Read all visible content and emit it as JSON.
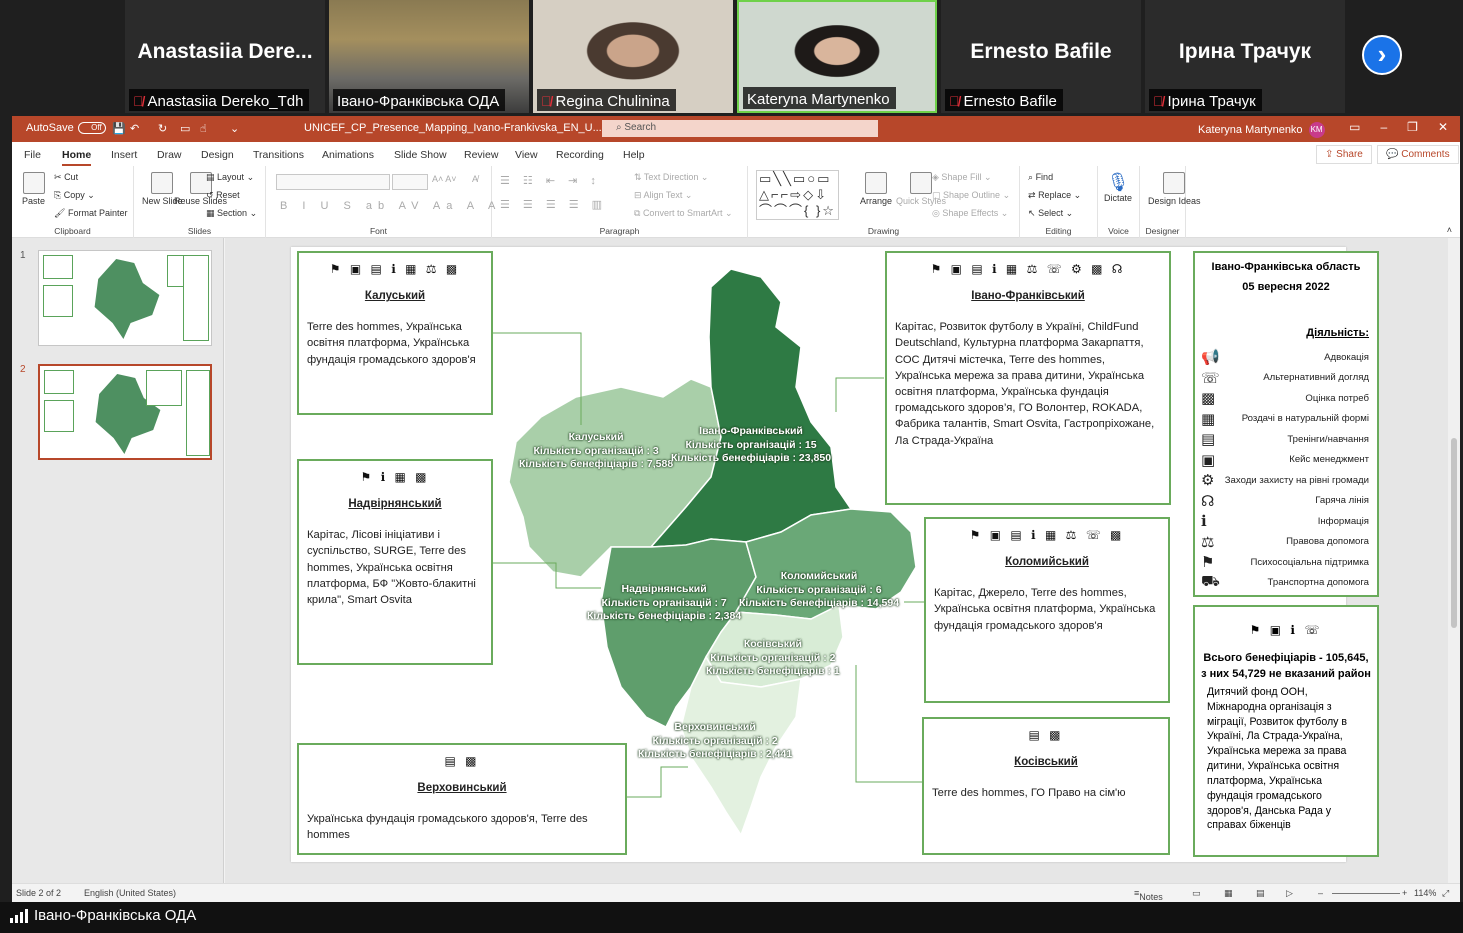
{
  "video": {
    "tiles": [
      {
        "big_name": "Anastasiia  Dere...",
        "caption": "Anastasiia Dereko_Tdh",
        "muted": true
      },
      {
        "caption": "Івано-Франківська ОДА",
        "muted": false
      },
      {
        "caption": "Regina Chulinina",
        "muted": true
      },
      {
        "caption": "Kateryna Martynenko",
        "muted": false
      },
      {
        "big_name": "Ernesto Bafile",
        "caption": "Ernesto Bafile",
        "muted": true
      },
      {
        "big_name": "Ірина Трачук",
        "caption": "Ірина Трачук",
        "muted": true
      }
    ],
    "next_icon": "chevron-right-icon",
    "bottom_caption": "Івано-Франківська ОДА"
  },
  "ppt": {
    "autosave_label": "AutoSave",
    "autosave_state": "Off",
    "file_name": "UNICEF_CP_Presence_Mapping_Ivano-Frankivska_EN_U...",
    "search_placeholder": "Search",
    "user_name": "Kateryna Martynenko",
    "user_initials": "KM",
    "menu": [
      "File",
      "Home",
      "Insert",
      "Draw",
      "Design",
      "Transitions",
      "Animations",
      "Slide Show",
      "Review",
      "View",
      "Recording",
      "Help"
    ],
    "active_menu": "Home",
    "share_label": "Share",
    "comments_label": "Comments",
    "ribbon": {
      "clipboard": {
        "label": "Clipboard",
        "paste": "Paste",
        "cut": "Cut",
        "copy": "Copy",
        "format_painter": "Format Painter"
      },
      "slides": {
        "label": "Slides",
        "new_slide": "New Slide",
        "reuse": "Reuse Slides",
        "layout": "Layout",
        "reset": "Reset",
        "section": "Section"
      },
      "font": {
        "label": "Font"
      },
      "paragraph": {
        "label": "Paragraph",
        "text_direction": "Text Direction",
        "align_text": "Align Text",
        "convert": "Convert to SmartArt"
      },
      "drawing": {
        "label": "Drawing",
        "arrange": "Arrange",
        "quick_styles": "Quick Styles",
        "fill": "Shape Fill",
        "outline": "Shape Outline",
        "effects": "Shape Effects"
      },
      "editing": {
        "label": "Editing",
        "find": "Find",
        "replace": "Replace",
        "select": "Select"
      },
      "voice": {
        "label": "Voice",
        "dictate": "Dictate"
      },
      "designer": {
        "label": "Designer",
        "design_ideas": "Design Ideas"
      }
    },
    "thumbnails": [
      {
        "num": "1"
      },
      {
        "num": "2"
      }
    ],
    "status": {
      "slide": "Slide 2 of 2",
      "language": "English (United States)",
      "notes": "Notes",
      "zoom": "114%"
    }
  },
  "slide": {
    "colors": {
      "dark": "#2e7a44",
      "mid": "#6aa877",
      "light": "#a9cfa9",
      "pale": "#d8ecd6",
      "border": "#6aab5c"
    },
    "regions": {
      "kalush": {
        "icons": "⚑ ▣ ▤ ℹ ▦ ⚖ ▩",
        "title": "Калуський",
        "orgs": "Terre des hommes, Українська освітня платформа, Українська фундація громадського здоров'я",
        "map_name": "Калуський",
        "map_count": "Кількість організацій : 3",
        "map_benef": "Кількість бенефіціарів : 7,588"
      },
      "ivano": {
        "icons": "⚑ ▣ ▤ ℹ ▦ ⚖ ☏ ⚙ ▩ ☊",
        "title": "Івано-Франківський",
        "orgs": "Карітас, Розвиток футболу в Україні, ChildFund Deutschland, Культурна платформа Закарпаття, СОС Дитячі містечка, Terre des hommes, Українська мережа за права дитини, Українська освітня платформа, Українська фундація громадського здоров’я, ГО Волонтер, ROKADA, Фабрика талантів, Smart Osvita, Гастропріхожане, Ла Страда-Україна",
        "map_name": "Івано-Франківський",
        "map_count": "Кількість організацій : 15",
        "map_benef": "Кількість бенефіціарів : 23,850"
      },
      "nadvirna": {
        "icons": "⚑ ℹ ▦ ▩",
        "title": "Надвірнянський",
        "orgs": "Карітас, Лісові ініціативи і суспільство, SURGE, Terre des hommes, Українська освітня платформа, БФ \"Жовто-блакитні крила\", Smart Osvita",
        "map_name": "Надвірнянський",
        "map_count": "Кількість організацій : 7",
        "map_benef": "Кількість бенефіціарів : 2,384"
      },
      "kolomyia": {
        "icons": "⚑ ▣ ▤ ℹ ▦ ⚖ ☏ ▩",
        "title": "Коломийський",
        "orgs": "Карітас, Джерело, Terre des hommes, Українська освітня платформа, Українська фундація громадського здоров'я",
        "map_name": "Коломийський",
        "map_count": "Кількість організацій : 6",
        "map_benef": "Кількість бенефіціарів : 14,594"
      },
      "kosiv": {
        "icons": "▤ ▩",
        "title": "Косівський",
        "orgs": "Terre des hommes, ГО Право на сім'ю",
        "map_name": "Косівський",
        "map_count": "Кількість організацій : 2",
        "map_benef": "Кількість бенефіціарів : 1"
      },
      "verkhovyna": {
        "icons": "▤ ▩",
        "title": "Верховинський",
        "orgs": "Українська фундація громадського здоров'я, Terre des hommes",
        "map_name": "Верховинський",
        "map_count": "Кількість організацій : 2",
        "map_benef": "Кількість бенефіціарів : 2,441"
      }
    },
    "legend": {
      "region": "Івано-Франківська область",
      "date": "05 вересня 2022",
      "title": "Діяльність:",
      "items": [
        {
          "icon": "📢",
          "label": "Адвокація"
        },
        {
          "icon": "☏",
          "label": "Альтернативний догляд"
        },
        {
          "icon": "▩",
          "label": "Оцінка потреб"
        },
        {
          "icon": "▦",
          "label": "Роздачі в натуральній формі"
        },
        {
          "icon": "▤",
          "label": "Тренінги/навчання"
        },
        {
          "icon": "▣",
          "label": "Кейс менеджмент"
        },
        {
          "icon": "⚙",
          "label": "Заходи захисту на рівні громади"
        },
        {
          "icon": "☊",
          "label": "Гаряча лінія"
        },
        {
          "icon": "ℹ",
          "label": "Інформація"
        },
        {
          "icon": "⚖",
          "label": "Правова допомога"
        },
        {
          "icon": "⚑",
          "label": "Психосоціальна підтримка"
        },
        {
          "icon": "⛟",
          "label": "Транспортна допомога"
        }
      ]
    },
    "total": {
      "icons": "⚑ ▣ ℹ ☏",
      "title": "Всього бенефіціарів - 105,645, з них 54,729 не вказаний район",
      "orgs": "Дитячий фонд ООН, Міжнародна організація з міграції, Розвиток футболу в Україні, Ла Страда-Україна, Українська мережа за права дитини, Українська освітня платформа, Українська фундація громадського здоров'я, Данська Рада у справах біженців"
    }
  }
}
